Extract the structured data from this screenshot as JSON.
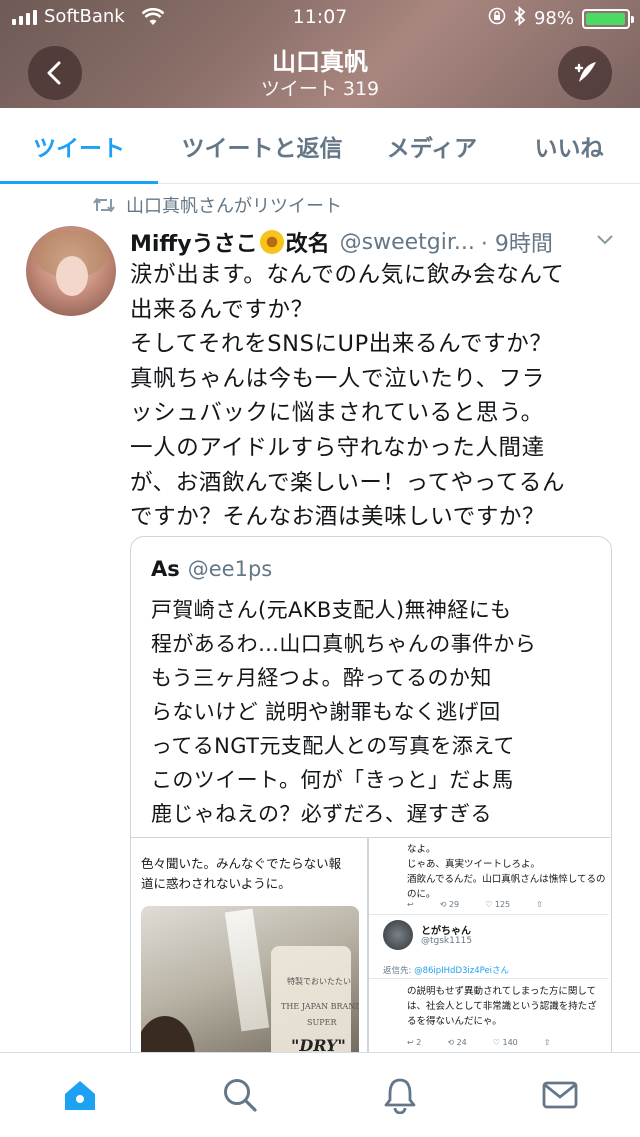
{
  "status": {
    "carrier": "SoftBank",
    "time": "11:07",
    "battery": "98%",
    "battery_level": 0.98
  },
  "header": {
    "title": "山口真帆",
    "subtitle": "ツイート 319",
    "back_icon": "chevron-left-icon",
    "compose_icon": "compose-feather-icon"
  },
  "tabs": [
    {
      "label": "ツイート",
      "active": true
    },
    {
      "label": "ツイートと返信",
      "active": false
    },
    {
      "label": "メディア",
      "active": false
    },
    {
      "label": "いいね",
      "active": false
    }
  ],
  "tweet": {
    "retweet_note": "山口真帆さんがリツイート",
    "name_part1": "Miffyうさこ",
    "name_part2": "改名",
    "handle": "@sweetgir...",
    "time": "· 9時間",
    "lines": [
      "涙が出ます。なんでのん気に飲み会なんて",
      "出来るんですか？",
      "そしてそれをSNSにUP出来るんですか？",
      "真帆ちゃんは今も一人で泣いたり、フラ",
      "ッシュバックに悩まされていると思う。",
      "一人のアイドルすら守れなかった人間達",
      "が、お酒飲んで楽しいー！ってやってるん",
      "ですか？そんなお酒は美味しいですか？"
    ]
  },
  "quote": {
    "name": "As",
    "handle": "@ee1ps",
    "lines": [
      "戸賀崎さん(元AKB支配人)無神経にも",
      "程があるわ…山口真帆ちゃんの事件から",
      "もう三ヶ月経つよ。酔ってるのか知",
      "らないけど 説明や謝罪もなく逃げ回",
      "ってるNGT元支配人との写真を添えて",
      "このツイート。何が「きっと」だよ馬",
      "鹿じゃねえの？必ずだろ、遅すぎる"
    ],
    "left_caption": [
      "色々聞いた。みんなぐでたらない報",
      "道に惑わされないように。"
    ],
    "photo_labels": {
      "l1": "特製でおいたたい",
      "l2": "THE JAPAN BRAND",
      "l3": "SUPER",
      "dry": "\"DRY\""
    },
    "right": {
      "top_lines": [
        "なよ。",
        "じゃあ、真実ツイートしろよ。",
        "酒飲んでるんだ。山口真帆さんは憔悴してるの",
        "のに。"
      ],
      "actions1": [
        "↩",
        "⟲ 29",
        "♡ 125",
        "⇧"
      ],
      "user_name": "とがちゃん",
      "user_handle": "@tgsk1115",
      "reply_to_label": "返信先:",
      "reply_to": "@86ipIHdD3iz4Peiさん",
      "bottom_lines": [
        "の説明もせず異動されてしまった方に関して",
        "は、社会人として非常識という認識を持たざ",
        "るを得ないんだにゃ。"
      ],
      "actions2": [
        "↩ 2",
        "⟲ 24",
        "♡ 140",
        "⇧"
      ]
    }
  },
  "bottom_nav": [
    {
      "icon": "home-icon",
      "active": true
    },
    {
      "icon": "search-icon",
      "active": false
    },
    {
      "icon": "notifications-bell-icon",
      "active": false
    },
    {
      "icon": "messages-envelope-icon",
      "active": false
    }
  ],
  "colors": {
    "accent": "#1da1f2",
    "battery": "#4cd964",
    "muted": "#657786"
  }
}
